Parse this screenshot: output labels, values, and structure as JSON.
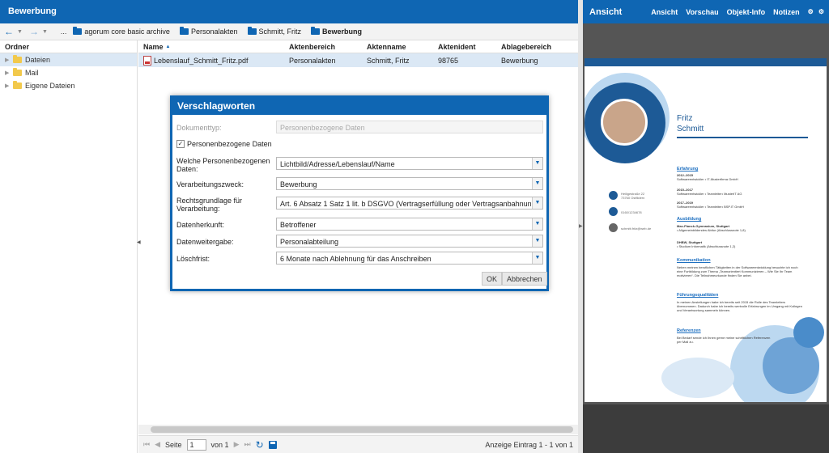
{
  "left": {
    "title": "Bewerbung",
    "breadcrumb": [
      {
        "label": "agorum core basic archive"
      },
      {
        "label": "Personalakten"
      },
      {
        "label": "Schmitt, Fritz"
      },
      {
        "label": "Bewerbung"
      }
    ],
    "tree": {
      "header": "Ordner",
      "items": [
        {
          "label": "Dateien"
        },
        {
          "label": "Mail"
        },
        {
          "label": "Eigene Dateien"
        }
      ]
    },
    "table": {
      "columns": [
        "Name",
        "Aktenbereich",
        "Aktenname",
        "Aktenident",
        "Ablagebereich"
      ],
      "rows": [
        {
          "name": "Lebenslauf_Schmitt_Fritz.pdf",
          "aktenbereich": "Personalakten",
          "aktenname": "Schmitt, Fritz",
          "aktenident": "98765",
          "ablagebereich": "Bewerbung"
        }
      ]
    },
    "pager": {
      "page_label": "Seite",
      "page_value": "1",
      "of_label": "von 1",
      "info": "Anzeige Eintrag 1 - 1 von 1"
    }
  },
  "dialog": {
    "title": "Verschlagworten",
    "dokumenttyp_label": "Dokumenttyp:",
    "dokumenttyp_value": "Personenbezogene Daten",
    "checkbox_label": "Personenbezogene Daten",
    "checkbox_checked": true,
    "fields": [
      {
        "label": "Welche Personenbezogenen Daten:",
        "value": "Lichtbild/Adresse/Lebenslauf/Name"
      },
      {
        "label": "Verarbeitungszweck:",
        "value": "Bewerbung"
      },
      {
        "label": "Rechtsgrundlage für Verarbeitung:",
        "value": "Art. 6 Absatz 1 Satz 1 lit. b DSGVO (Vertragserfüllung oder Vertragsanbahnung)"
      },
      {
        "label": "Datenherkunft:",
        "value": "Betroffener"
      },
      {
        "label": "Datenweitergabe:",
        "value": "Personalabteilung"
      },
      {
        "label": "Löschfrist:",
        "value": "6 Monate nach Ablehnung für das Anschreiben"
      }
    ],
    "ok_label": "OK",
    "cancel_label": "Abbrechen"
  },
  "right": {
    "title": "Ansicht",
    "links": [
      "Ansicht",
      "Vorschau",
      "Objekt-Info",
      "Notizen"
    ],
    "cv": {
      "first_name": "Fritz",
      "last_name": "Schmitt",
      "address": "Heiligestraße 22\n73760 Ostfildern",
      "phone": "0160/1234678",
      "email": "schmitt.fritz@web.de",
      "sections": {
        "erfahrung": "Erfahrung",
        "ausbildung": "Ausbildung",
        "kommunikation": "Kommunikation",
        "fuehrung": "Führungsqualitäten",
        "referenzen": "Referenzen"
      },
      "erfahrung_entries": [
        {
          "years": "2012–2015",
          "text": "Softwareentwickler • IT-Musterfirma GmbH"
        },
        {
          "years": "2015–2017",
          "text": "Softwareentwickler • Teamleiter• MusterIT AG"
        },
        {
          "years": "2017–2019",
          "text": "Softwareentwickler • Teamleiter• BSP.IT GmbH"
        }
      ],
      "ausbildung_entries": [
        {
          "school": "Max-Planck-Gymnasium, Stuttgart",
          "detail": "Allgemeinbildendes Abitur (Abschlussnote 1,8)"
        },
        {
          "school": "DHBW, Stuttgart",
          "detail": "Studium Informatik (Abschlussnote 1,2)"
        }
      ],
      "kommunikation_text": "Neben meinen beruflichen Tätigkeiten in der Softwareentwicklung besuchte ich noch eine Fortbildung zum Thema „Teamorientiert Kommunizieren – Wie Sie Ihr Team motivieren“. Die Teilnahmeurkunde finden Sie anbei.",
      "fuehrung_text": "In meinen Anstellungen habe ich bereits seit 2015 die Rolle des Teamleiters übernommen. Dadurch habe ich bereits wertvolle Erfahrungen im Umgang mit Kollegen und Verantwortung sammeln können.",
      "referenzen_text": "Bei Bedarf sende ich Ihnen gerne meine schriftlichen Referenzen per Mail zu."
    }
  }
}
